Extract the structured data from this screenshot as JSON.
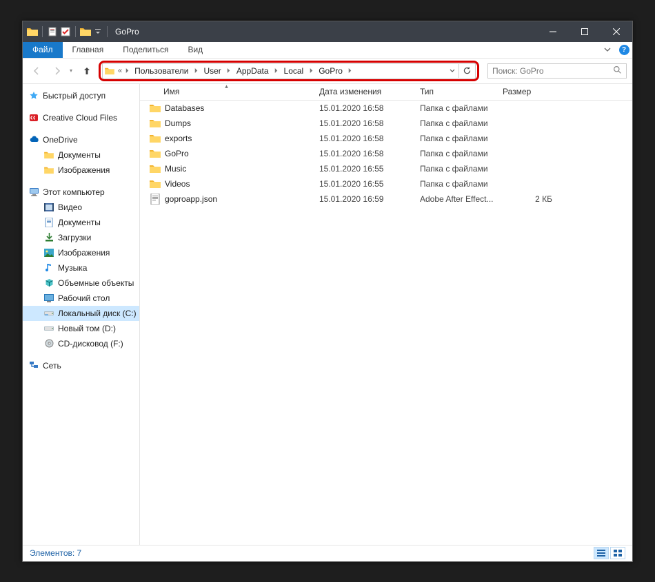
{
  "window": {
    "title": "GoPro"
  },
  "ribbon": {
    "file": "Файл",
    "home": "Главная",
    "share": "Поделиться",
    "view": "Вид"
  },
  "breadcrumbs": [
    "Пользователи",
    "User",
    "AppData",
    "Local",
    "GoPro"
  ],
  "search": {
    "placeholder": "Поиск: GoPro"
  },
  "columns": {
    "name": "Имя",
    "date": "Дата изменения",
    "type": "Тип",
    "size": "Размер"
  },
  "sidebar": {
    "quick": "Быстрый доступ",
    "ccf": "Creative Cloud Files",
    "onedrive": "OneDrive",
    "od_docs": "Документы",
    "od_pics": "Изображения",
    "pc": "Этот компьютер",
    "pc_video": "Видео",
    "pc_docs": "Документы",
    "pc_dl": "Загрузки",
    "pc_pics": "Изображения",
    "pc_music": "Музыка",
    "pc_3d": "Объемные объекты",
    "pc_desk": "Рабочий стол",
    "pc_c": "Локальный диск (C:)",
    "pc_d": "Новый том (D:)",
    "pc_cd": "CD-дисковод (F:)",
    "net": "Сеть"
  },
  "rows": [
    {
      "icon": "folder",
      "name": "Databases",
      "date": "15.01.2020 16:58",
      "type": "Папка с файлами",
      "size": ""
    },
    {
      "icon": "folder",
      "name": "Dumps",
      "date": "15.01.2020 16:58",
      "type": "Папка с файлами",
      "size": ""
    },
    {
      "icon": "folder",
      "name": "exports",
      "date": "15.01.2020 16:58",
      "type": "Папка с файлами",
      "size": ""
    },
    {
      "icon": "folder",
      "name": "GoPro",
      "date": "15.01.2020 16:58",
      "type": "Папка с файлами",
      "size": ""
    },
    {
      "icon": "folder",
      "name": "Music",
      "date": "15.01.2020 16:55",
      "type": "Папка с файлами",
      "size": ""
    },
    {
      "icon": "folder",
      "name": "Videos",
      "date": "15.01.2020 16:55",
      "type": "Папка с файлами",
      "size": ""
    },
    {
      "icon": "json",
      "name": "goproapp.json",
      "date": "15.01.2020 16:59",
      "type": "Adobe After Effect...",
      "size": "2 КБ"
    }
  ],
  "status": {
    "items_label": "Элементов: 7"
  }
}
